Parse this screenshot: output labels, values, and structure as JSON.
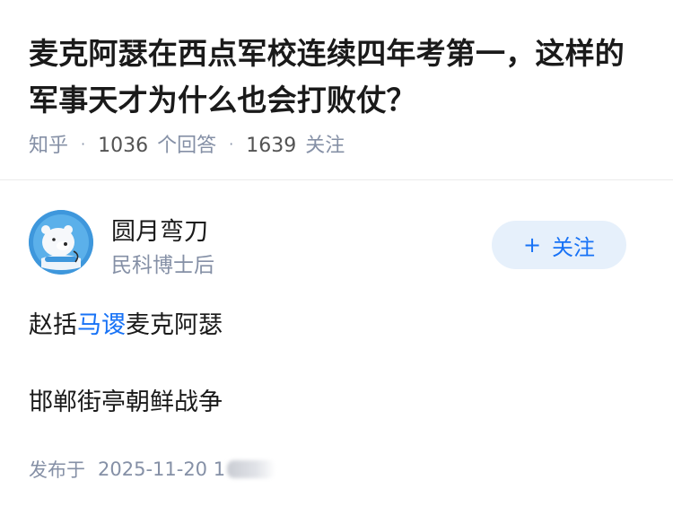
{
  "question": {
    "title": "麦克阿瑟在西点军校连续四年考第一，这样的军事天才为什么也会打败仗？"
  },
  "meta": {
    "source": "知乎",
    "separator": "·",
    "answers_count": "1036",
    "answers_label": "个回答",
    "followers_count": "1639",
    "followers_label": "关注"
  },
  "author": {
    "name": "圆月弯刀",
    "bio": "民科博士后",
    "avatar_icon": "avatar-icon"
  },
  "follow_button": {
    "plus": "+",
    "label": "关注"
  },
  "answer": {
    "line1_before": "赵括",
    "line1_link": "马谡",
    "line1_after": "麦克阿瑟",
    "line2": "邯郸街亭朝鲜战争"
  },
  "publish": {
    "label": "发布于",
    "time": "2025-11-20 1"
  },
  "colors": {
    "link": "#1772f6",
    "meta": "#8590a6",
    "button_bg": "#e6f0fb"
  }
}
